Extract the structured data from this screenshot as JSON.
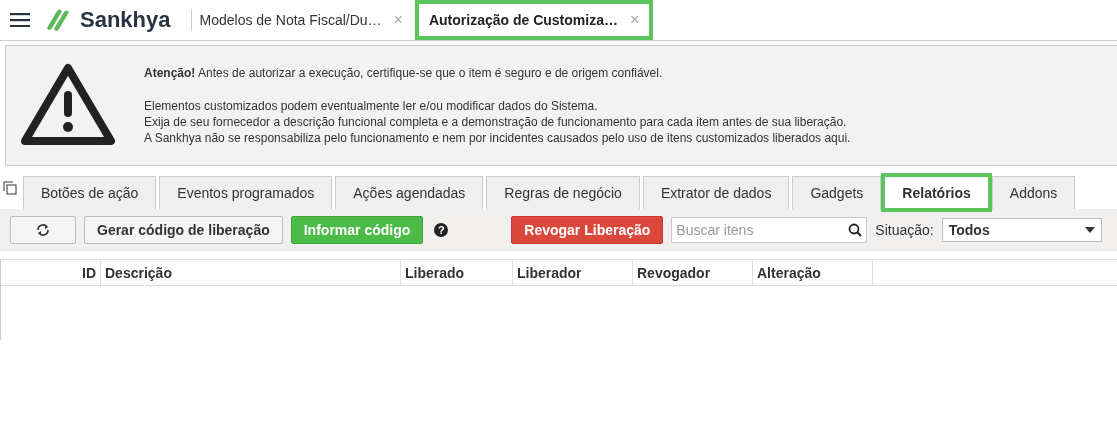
{
  "app": {
    "logo": "Sankhya"
  },
  "open_tabs": [
    {
      "label": "Modelos de Nota Fiscal/Du…",
      "close": "×",
      "selected": false
    },
    {
      "label": "Autorização de Customiza…",
      "close": "×",
      "selected": true
    }
  ],
  "warning": {
    "headline": "**Atenção!** Antes de autorizar a execução, certifique-se que o item é seguro e de origem confiável.",
    "lines": [
      "Elementos customizados podem eventualmente ler e/ou modificar dados do Sistema.",
      "Exija de seu fornecedor a descrição funcional completa e a demonstração de funcionamento para cada item antes de sua liberação.",
      "A Sankhya não se responsabiliza pelo funcionamento e nem por incidentes causados pelo uso de itens customizados liberados aqui."
    ]
  },
  "tabs": [
    {
      "label": "Botões de ação",
      "selected": false
    },
    {
      "label": "Eventos programados",
      "selected": false
    },
    {
      "label": "Ações agendadas",
      "selected": false
    },
    {
      "label": "Regras de negócio",
      "selected": false
    },
    {
      "label": "Extrator de dados",
      "selected": false
    },
    {
      "label": "Gadgets",
      "selected": false
    },
    {
      "label": "Relatórios",
      "selected": true
    },
    {
      "label": "Addons",
      "selected": false
    }
  ],
  "toolbar": {
    "generate": "Gerar código de liberação",
    "inform": "Informar código",
    "help": "?",
    "revoke": "Revogar Liberação",
    "search": {
      "placeholder": "Buscar itens"
    },
    "status_label": "Situação:",
    "status_value": "Todos"
  },
  "table": {
    "columns": [
      "ID",
      "Descrição",
      "Liberado",
      "Liberador",
      "Revogador",
      "Alteração"
    ]
  }
}
